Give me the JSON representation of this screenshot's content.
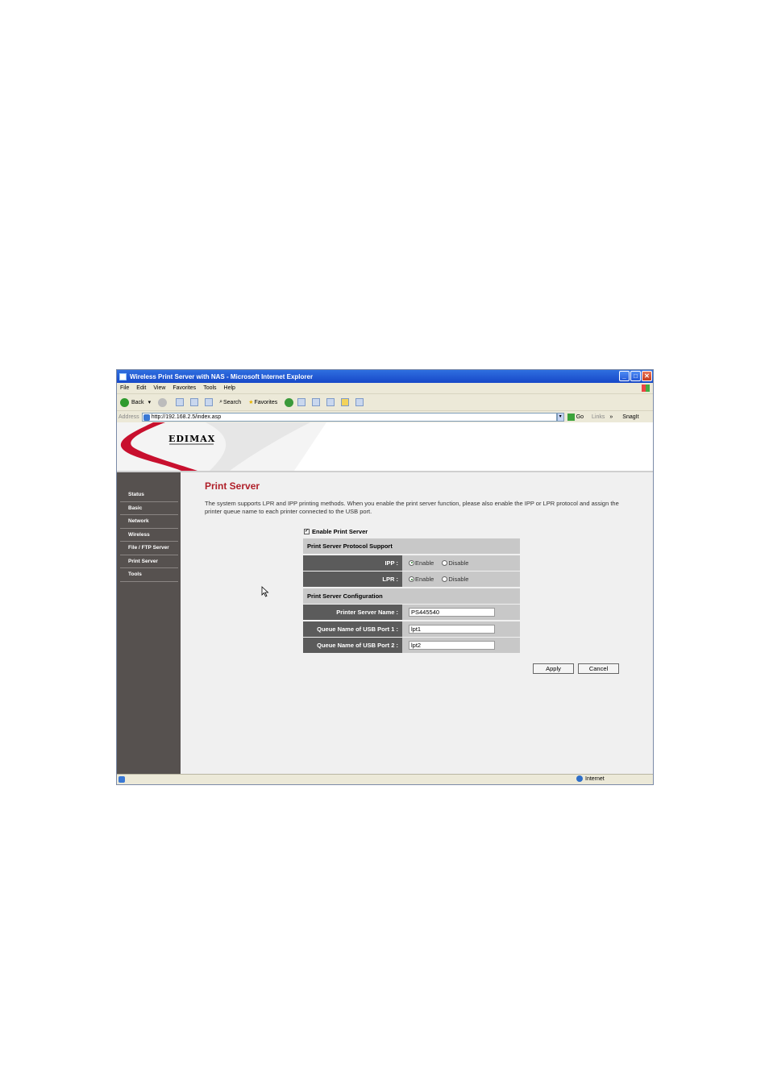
{
  "window": {
    "title": "Wireless Print Server with NAS - Microsoft Internet Explorer"
  },
  "menu": [
    "File",
    "Edit",
    "View",
    "Favorites",
    "Tools",
    "Help"
  ],
  "toolbar": {
    "back": "Back",
    "search": "Search",
    "favorites": "Favorites"
  },
  "address": {
    "label": "Address",
    "url": "http://192.168.2.5/index.asp",
    "go": "Go",
    "links": "Links",
    "snagit": "SnagIt"
  },
  "logo": {
    "text": "EDIMAX"
  },
  "sidebar": {
    "items": [
      "Status",
      "Basic",
      "Network",
      "Wireless",
      "File / FTP Server",
      "Print Server",
      "Tools"
    ]
  },
  "main": {
    "title": "Print Server",
    "description": "The system supports LPR and IPP printing methods. When you enable the print server function, please also enable the IPP or LPR protocol and assign the printer queue name to each printer connected to the USB port.",
    "enable_label": "Enable Print Server",
    "enable_checked": true,
    "protocol_header": "Print Server Protocol Support",
    "ipp_label": "IPP :",
    "lpr_label": "LPR :",
    "enable_option": "Enable",
    "disable_option": "Disable",
    "config_header": "Print Server Configuration",
    "printer_name_label": "Printer Server Name :",
    "printer_name_value": "PS445540",
    "queue1_label": "Queue Name of USB Port 1 :",
    "queue1_value": "lpt1",
    "queue2_label": "Queue Name of USB Port 2 :",
    "queue2_value": "lpt2",
    "apply": "Apply",
    "cancel": "Cancel"
  },
  "statusbar": {
    "zone": "Internet"
  }
}
